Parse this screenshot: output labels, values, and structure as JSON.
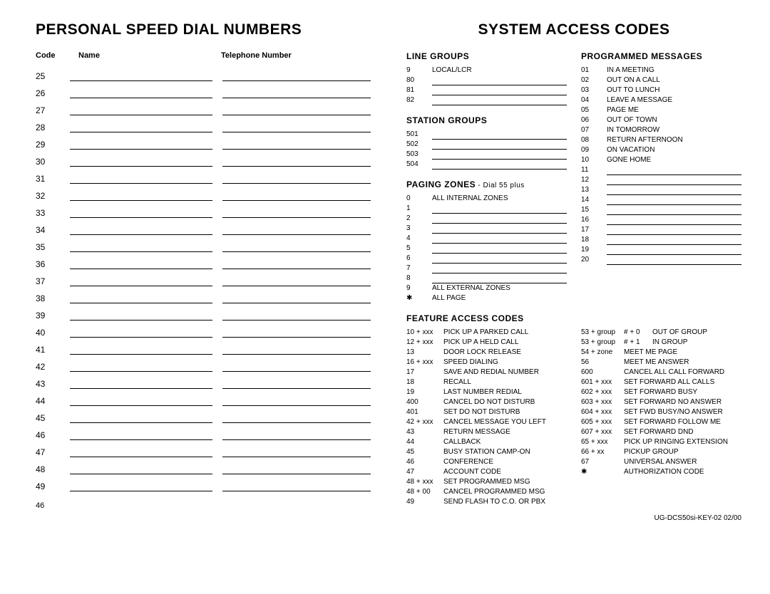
{
  "left": {
    "title": "PERSONAL SPEED DIAL NUMBERS",
    "headers": {
      "code": "Code",
      "name": "Name",
      "tel": "Telephone Number"
    },
    "codes": [
      "25",
      "26",
      "27",
      "28",
      "29",
      "30",
      "31",
      "32",
      "33",
      "34",
      "35",
      "36",
      "37",
      "38",
      "39",
      "40",
      "41",
      "42",
      "43",
      "44",
      "45",
      "46",
      "47",
      "48",
      "49"
    ],
    "page_num": "46"
  },
  "right": {
    "title": "SYSTEM ACCESS CODES",
    "line_groups": {
      "title": "LINE GROUPS",
      "rows": [
        {
          "c": "9",
          "t": "LOCAL/LCR"
        },
        {
          "c": "80",
          "t": ""
        },
        {
          "c": "81",
          "t": ""
        },
        {
          "c": "82",
          "t": ""
        }
      ]
    },
    "station_groups": {
      "title": "STATION GROUPS",
      "rows": [
        {
          "c": "501",
          "t": ""
        },
        {
          "c": "502",
          "t": ""
        },
        {
          "c": "503",
          "t": ""
        },
        {
          "c": "504",
          "t": ""
        }
      ]
    },
    "paging_zones": {
      "title": "PAGING ZONES",
      "note": " - Dial 55 plus",
      "rows": [
        {
          "c": "0",
          "t": "ALL INTERNAL ZONES"
        },
        {
          "c": "1",
          "t": ""
        },
        {
          "c": "2",
          "t": ""
        },
        {
          "c": "3",
          "t": ""
        },
        {
          "c": "4",
          "t": ""
        },
        {
          "c": "5",
          "t": ""
        },
        {
          "c": "6",
          "t": ""
        },
        {
          "c": "7",
          "t": ""
        },
        {
          "c": "8",
          "t": ""
        },
        {
          "c": "9",
          "t": "ALL EXTERNAL ZONES"
        },
        {
          "c": "✱",
          "t": "ALL PAGE"
        }
      ]
    },
    "programmed_messages": {
      "title": "PROGRAMMED MESSAGES",
      "rows": [
        {
          "c": "01",
          "t": "IN A MEETING"
        },
        {
          "c": "02",
          "t": "OUT ON A CALL"
        },
        {
          "c": "03",
          "t": "OUT TO LUNCH"
        },
        {
          "c": "04",
          "t": "LEAVE A MESSAGE"
        },
        {
          "c": "05",
          "t": "PAGE ME"
        },
        {
          "c": "06",
          "t": "OUT OF TOWN"
        },
        {
          "c": "07",
          "t": "IN TOMORROW"
        },
        {
          "c": "08",
          "t": "RETURN AFTERNOON"
        },
        {
          "c": "09",
          "t": "ON VACATION"
        },
        {
          "c": "10",
          "t": "GONE HOME"
        },
        {
          "c": "11",
          "t": ""
        },
        {
          "c": "12",
          "t": ""
        },
        {
          "c": "13",
          "t": ""
        },
        {
          "c": "14",
          "t": ""
        },
        {
          "c": "15",
          "t": ""
        },
        {
          "c": "16",
          "t": ""
        },
        {
          "c": "17",
          "t": ""
        },
        {
          "c": "18",
          "t": ""
        },
        {
          "c": "19",
          "t": ""
        },
        {
          "c": "20",
          "t": ""
        }
      ]
    },
    "feature_access": {
      "title": "FEATURE ACCESS CODES",
      "left_col": [
        {
          "c": "10 + xxx",
          "d": "PICK UP A PARKED CALL"
        },
        {
          "c": "12 + xxx",
          "d": "PICK UP A HELD CALL"
        },
        {
          "c": "13",
          "d": "DOOR LOCK RELEASE"
        },
        {
          "c": "16 + xxx",
          "d": "SPEED DIALING"
        },
        {
          "c": "17",
          "d": "SAVE AND REDIAL NUMBER"
        },
        {
          "c": "18",
          "d": "RECALL"
        },
        {
          "c": "19",
          "d": "LAST NUMBER REDIAL"
        },
        {
          "c": "400",
          "d": "CANCEL DO NOT DISTURB"
        },
        {
          "c": "401",
          "d": "SET DO NOT DISTURB"
        },
        {
          "c": "42 + xxx",
          "d": "CANCEL MESSAGE YOU LEFT"
        },
        {
          "c": "43",
          "d": "RETURN MESSAGE"
        },
        {
          "c": "44",
          "d": "CALLBACK"
        },
        {
          "c": "45",
          "d": "BUSY STATION CAMP-ON"
        },
        {
          "c": "46",
          "d": "CONFERENCE"
        },
        {
          "c": "47",
          "d": "ACCOUNT CODE"
        },
        {
          "c": "48 + xxx",
          "d": "SET PROGRAMMED MSG"
        },
        {
          "c": "48 + 00",
          "d": "CANCEL PROGRAMMED MSG"
        },
        {
          "c": "49",
          "d": "SEND FLASH TO C.O. OR PBX"
        }
      ],
      "right_col": [
        {
          "c": "53 + group",
          "c2": "# + 0",
          "d": "OUT OF GROUP"
        },
        {
          "c": "53 + group",
          "c2": "# + 1",
          "d": "IN GROUP"
        },
        {
          "c": "54 + zone",
          "c2": "",
          "d": "MEET ME PAGE"
        },
        {
          "c": "56",
          "c2": "",
          "d": "MEET ME ANSWER"
        },
        {
          "c": "600",
          "c2": "",
          "d": "CANCEL ALL CALL FORWARD"
        },
        {
          "c": "601 + xxx",
          "c2": "",
          "d": "SET FORWARD ALL CALLS"
        },
        {
          "c": "602 + xxx",
          "c2": "",
          "d": "SET FORWARD BUSY"
        },
        {
          "c": "603 + xxx",
          "c2": "",
          "d": "SET FORWARD NO ANSWER"
        },
        {
          "c": "604 + xxx",
          "c2": "",
          "d": "SET FWD BUSY/NO ANSWER"
        },
        {
          "c": "605 + xxx",
          "c2": "",
          "d": "SET FORWARD FOLLOW ME"
        },
        {
          "c": "607 + xxx",
          "c2": "",
          "d": "SET FORWARD DND"
        },
        {
          "c": "65 + xxx",
          "c2": "",
          "d": "PICK UP RINGING EXTENSION"
        },
        {
          "c": "66 + xx",
          "c2": "",
          "d": "PICKUP GROUP"
        },
        {
          "c": "67",
          "c2": "",
          "d": "UNIVERSAL ANSWER"
        },
        {
          "c": "✱",
          "c2": "",
          "d": "AUTHORIZATION CODE"
        }
      ]
    },
    "footer": "UG-DCS50si-KEY-02  02/00"
  }
}
